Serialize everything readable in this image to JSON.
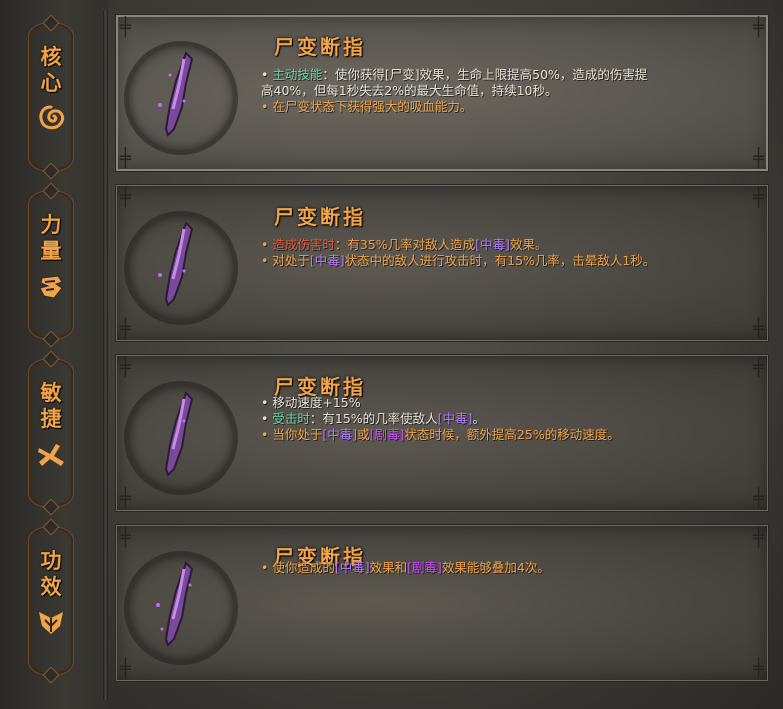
{
  "sidebar": {
    "tabs": [
      {
        "chars": [
          "核",
          "心"
        ],
        "icon": "core-swirl-icon"
      },
      {
        "chars": [
          "力",
          "量"
        ],
        "icon": "strength-fist-icon"
      },
      {
        "chars": [
          "敏",
          "捷"
        ],
        "icon": "agility-runner-icon"
      },
      {
        "chars": [
          "功",
          "效"
        ],
        "icon": "effect-leaf-icon"
      }
    ]
  },
  "panels": [
    {
      "title": "尸变断指",
      "icon": "severed-finger-icon",
      "lines": [
        {
          "bullet": "•",
          "segments": [
            "主动技能",
            "：使你获得[尸变]效果，生命上限提高50%，造成的伤害提"
          ]
        },
        {
          "bullet": "",
          "segments": [
            "高40%，但每1秒失去2%的最大生命值，持续10秒。"
          ]
        },
        {
          "bullet": "•",
          "segments": [
            "在尸变状态下获得强大的吸血能力。"
          ]
        }
      ]
    },
    {
      "title": "尸变断指",
      "icon": "severed-finger-icon",
      "lines": [
        {
          "bullet": "•",
          "segments": [
            "造成伤害时",
            "：有35%几率对敌人造成",
            "[中毒]",
            "效果。"
          ]
        },
        {
          "bullet": "•",
          "segments": [
            "对处于",
            "[中毒]",
            "状态中的敌人进行攻击时，有15%几率，击晕敌人1秒。"
          ]
        }
      ]
    },
    {
      "title": "尸变断指",
      "icon": "severed-finger-icon",
      "lines": [
        {
          "bullet": "•",
          "segments": [
            "移动速度+15%"
          ]
        },
        {
          "bullet": "•",
          "segments": [
            "受击时",
            "：有15%的几率使敌人",
            "[中毒]",
            "。"
          ]
        },
        {
          "bullet": "•",
          "segments": [
            "当你处于",
            "[中毒]",
            "或",
            "[剧毒]",
            "状态时候，额外提高25%的移动速度。"
          ]
        }
      ]
    },
    {
      "title": "尸变断指",
      "icon": "severed-finger-icon",
      "lines": [
        {
          "bullet": "•",
          "segments": [
            "使你造成的",
            "[中毒]",
            "效果和",
            "[剧毒]",
            "效果能够叠加4次。"
          ]
        }
      ]
    }
  ],
  "colors": {
    "title": "#f0a347",
    "body": "#e6e1d4",
    "skill": "#63d6a3",
    "trigger": "#e25a3a",
    "poison": "#b27bff",
    "venom": "#d048ff"
  }
}
